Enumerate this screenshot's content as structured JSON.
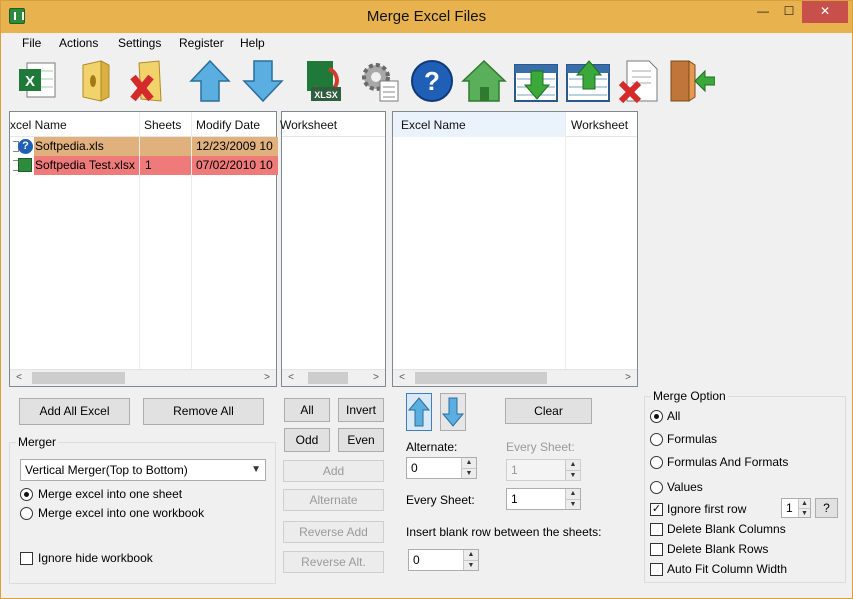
{
  "window": {
    "title": "Merge Excel Files",
    "min_glyph": "—",
    "max_glyph": "☐",
    "close_glyph": "✕"
  },
  "menu": [
    "File",
    "Actions",
    "Settings",
    "Register",
    "Help"
  ],
  "toolbar": [
    "excel-file-icon",
    "open-folder-icon",
    "remove-file-icon",
    "move-up-icon",
    "move-down-icon",
    "xlsx-convert-icon",
    "settings-icon",
    "help-icon",
    "home-icon",
    "import-sheet-icon",
    "export-sheet-icon",
    "delete-document-icon",
    "exit-icon"
  ],
  "colors": {
    "title_bar": "#e8b34e",
    "row_selected": "#e0b07d",
    "row_error": "#ef7a7a",
    "close_button": "#c7504a"
  },
  "files_list": {
    "headers": [
      "xcel Name",
      "Sheets",
      "Modify Date"
    ],
    "rows": [
      {
        "name": "Softpedia.xls",
        "sheets": "",
        "date": "12/23/2009 10",
        "icon": "question-icon"
      },
      {
        "name": "Softpedia Test.xlsx",
        "sheets": "1",
        "date": "07/02/2010 10",
        "icon": "excel-icon"
      }
    ]
  },
  "worksheet_list": {
    "header": "Worksheet"
  },
  "target_list": {
    "headers": [
      "Excel Name",
      "Worksheet"
    ]
  },
  "buttons": {
    "add_all": "Add All Excel",
    "remove_all": "Remove All",
    "all": "All",
    "invert": "Invert",
    "odd": "Odd",
    "even": "Even",
    "add": "Add",
    "alternate": "Alternate",
    "reverse_add": "Reverse Add",
    "reverse_alt": "Reverse Alt.",
    "clear": "Clear",
    "help": "?"
  },
  "merger": {
    "title": "Merger",
    "type": "Vertical Merger(Top to Bottom)",
    "options": [
      "Merge excel into one sheet",
      "Merge excel into one workbook"
    ],
    "selected": 0,
    "ignore_hide": "Ignore hide workbook"
  },
  "settings": {
    "alternate_label": "Alternate:",
    "alternate_value": "0",
    "every_sheet_label_1": "Every Sheet:",
    "every_sheet_value_1": "1",
    "every_sheet_label_2": "Every Sheet:",
    "every_sheet_value_2": "1",
    "blank_row_label": "Insert blank row between the sheets:",
    "blank_row_value": "0"
  },
  "merge_option": {
    "title": "Merge Option",
    "radios": [
      "All",
      "Formulas",
      "Formulas And Formats",
      "Values"
    ],
    "selected": 0,
    "ignore_first_row": "Ignore first row",
    "ignore_first_row_value": "1",
    "delete_blank_columns": "Delete Blank Columns",
    "delete_blank_rows": "Delete Blank Rows",
    "auto_fit": "Auto Fit Column Width"
  }
}
